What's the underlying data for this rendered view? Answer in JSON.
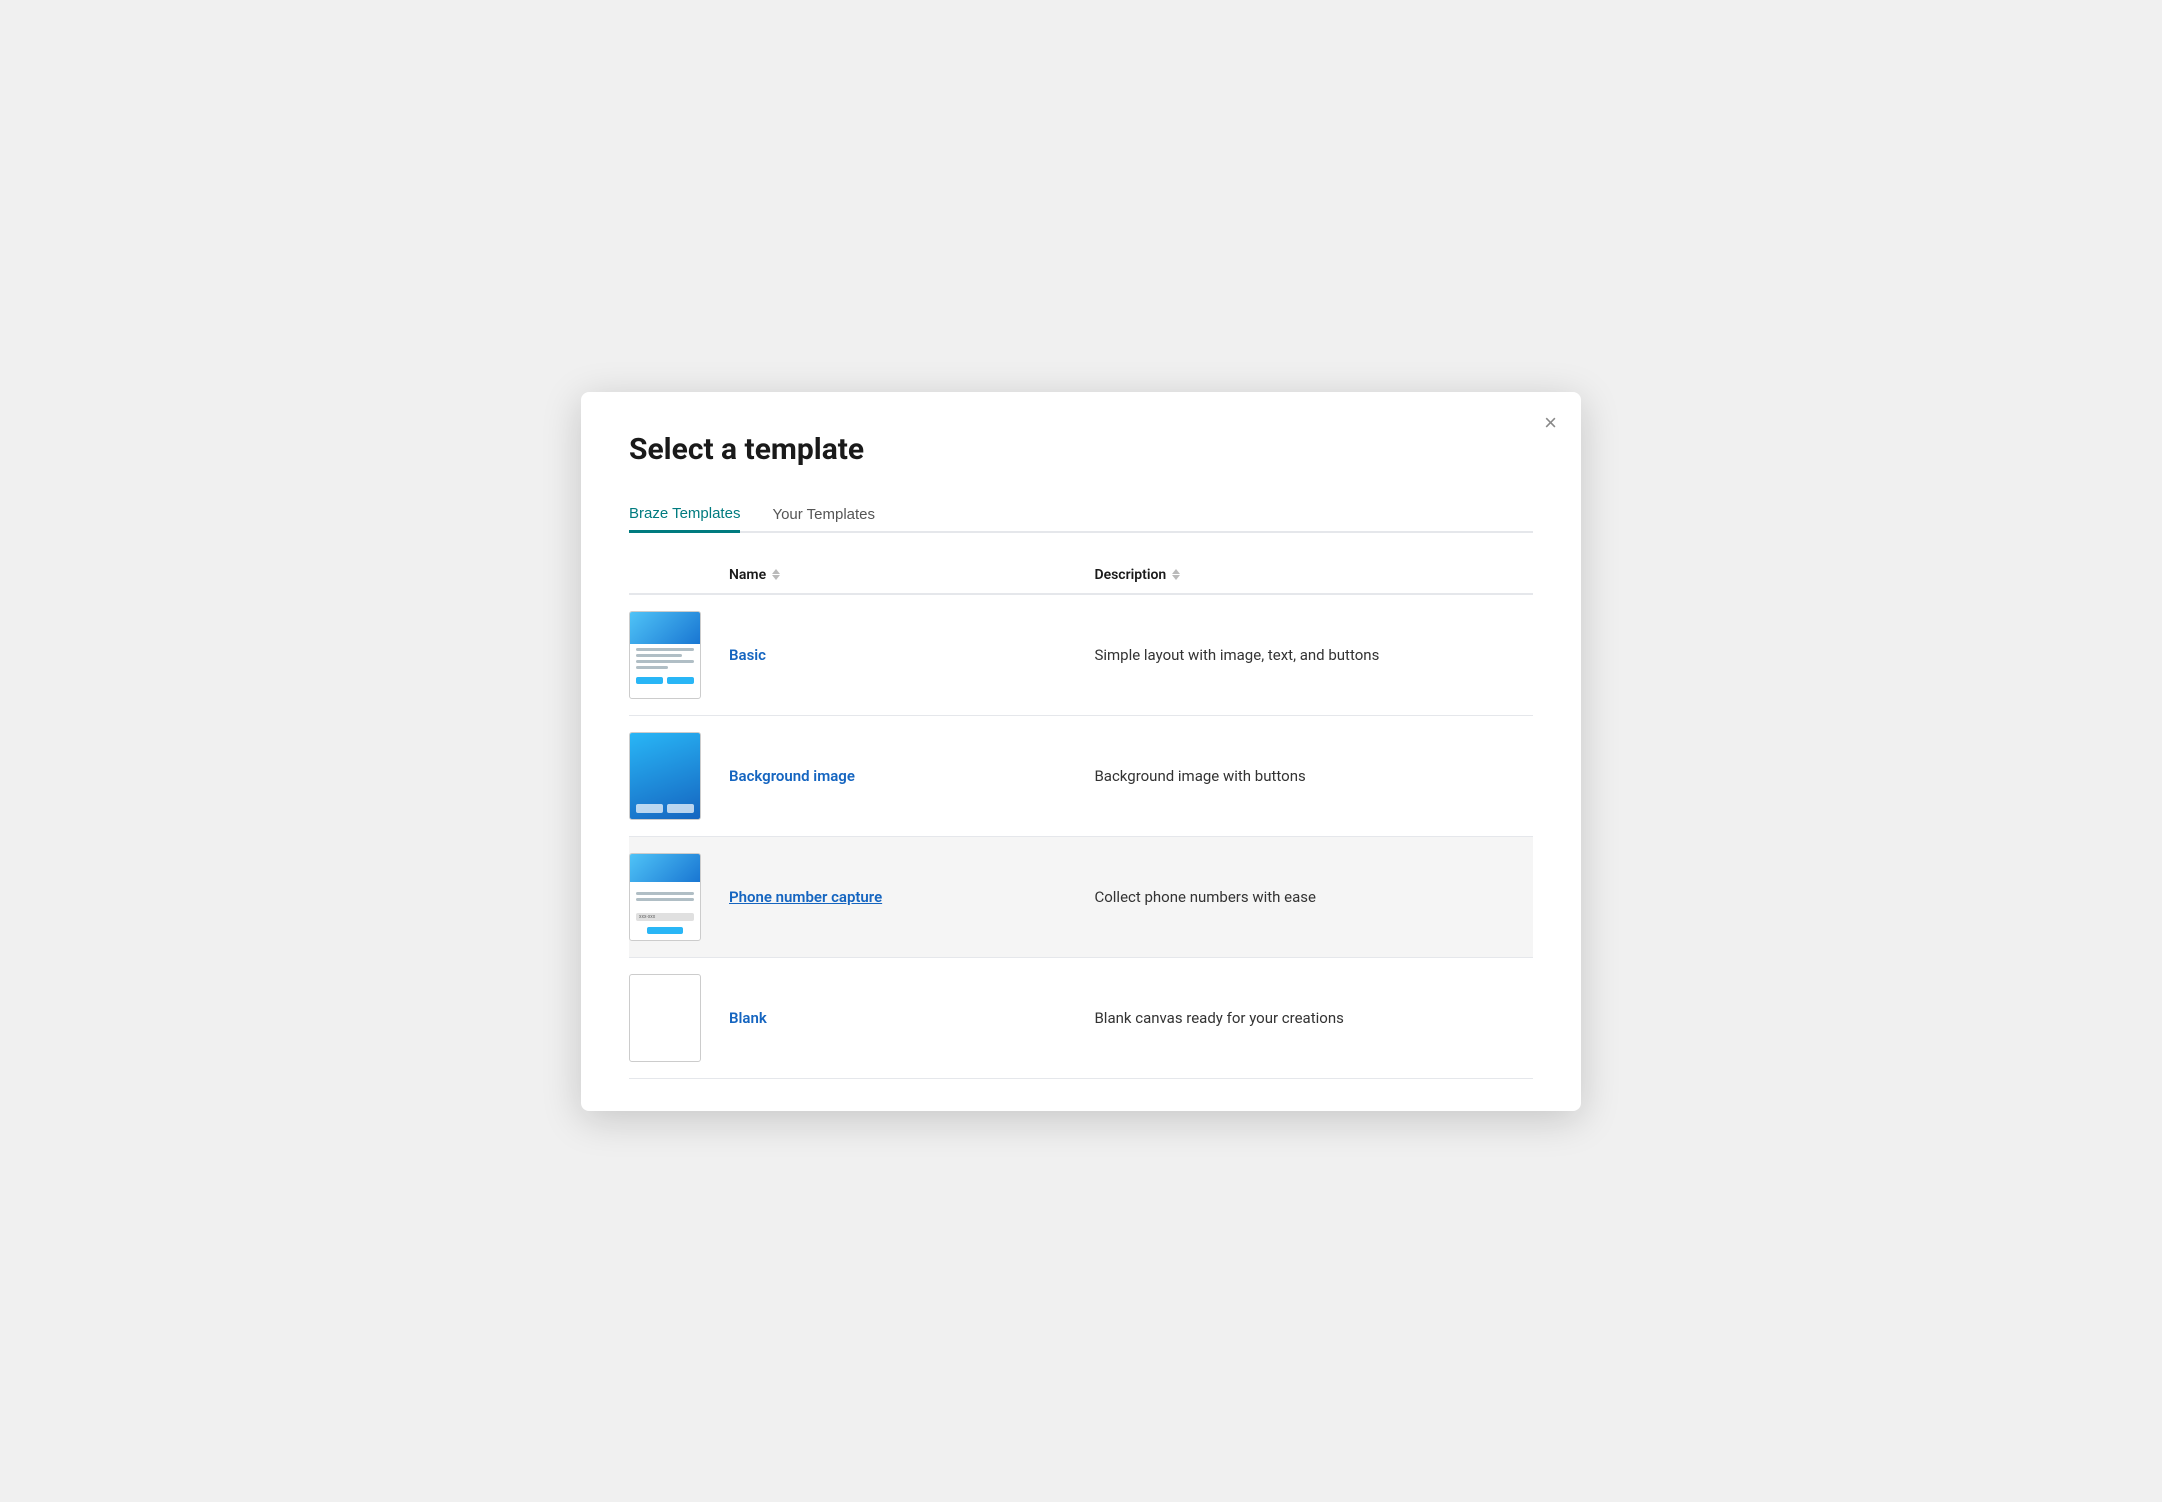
{
  "modal": {
    "title": "Select a template",
    "close_label": "×"
  },
  "tabs": [
    {
      "id": "braze",
      "label": "Braze Templates",
      "active": true
    },
    {
      "id": "your",
      "label": "Your Templates",
      "active": false
    }
  ],
  "table": {
    "col_name": "Name",
    "col_desc": "Description"
  },
  "templates": [
    {
      "id": "basic",
      "name": "Basic",
      "description": "Simple layout with image, text, and buttons",
      "highlighted": false,
      "underlined": false,
      "thumb_type": "basic"
    },
    {
      "id": "background-image",
      "name": "Background image",
      "description": "Background image with buttons",
      "highlighted": false,
      "underlined": false,
      "thumb_type": "bgimg"
    },
    {
      "id": "phone-number-capture",
      "name": "Phone number capture",
      "description": "Collect phone numbers with ease",
      "highlighted": true,
      "underlined": true,
      "thumb_type": "phone"
    },
    {
      "id": "blank",
      "name": "Blank",
      "description": "Blank canvas ready for your creations",
      "highlighted": false,
      "underlined": false,
      "thumb_type": "blank"
    }
  ],
  "colors": {
    "active_tab": "#007b7f",
    "link": "#1565c0"
  }
}
